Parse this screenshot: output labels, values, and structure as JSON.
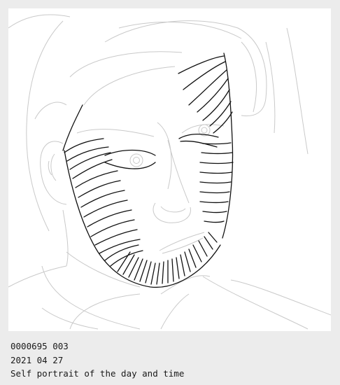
{
  "artwork": {
    "description_icon": "portrait-drawing"
  },
  "caption": {
    "id_line": "0000695 003",
    "date_line": "2021 04 27",
    "title_line": "Self portrait of the day and time"
  },
  "colors": {
    "background": "#ececec",
    "canvas": "#ffffff",
    "sketch_gray": "#c8c8c8",
    "ink": "#111111"
  }
}
